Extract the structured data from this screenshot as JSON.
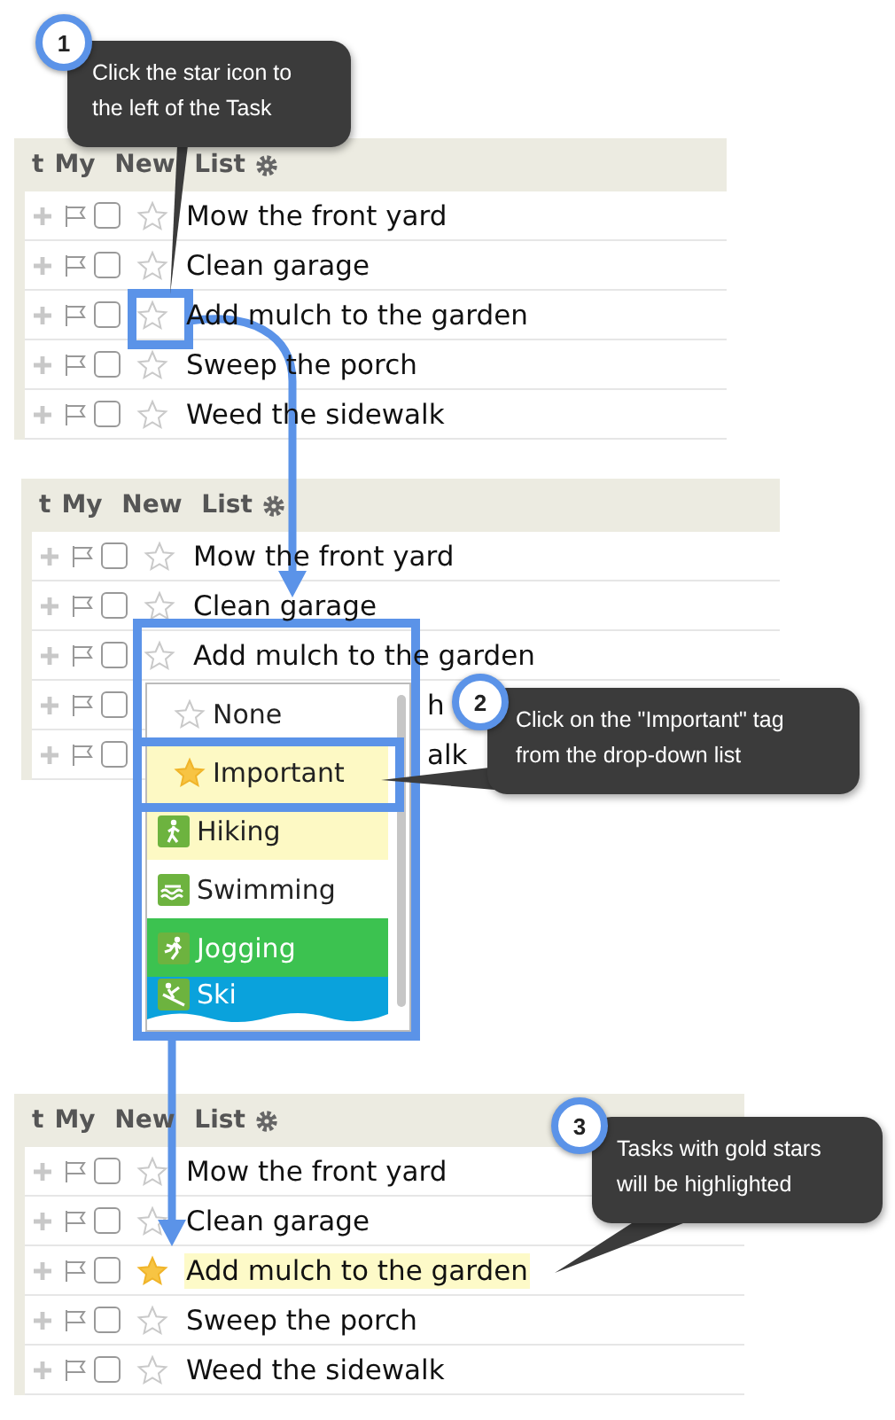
{
  "panels": [
    {
      "handle": "t",
      "title": "My New List",
      "tasks": [
        {
          "kind": "full",
          "text": "Mow the front yard",
          "done": false,
          "starred": false,
          "highlighted": false
        },
        {
          "kind": "full",
          "text": "Clean garage",
          "done": false,
          "starred": false,
          "highlighted": false
        },
        {
          "kind": "full",
          "text": "Add mulch to the garden",
          "done": false,
          "starred": false,
          "highlighted": false
        },
        {
          "kind": "full",
          "text": "Sweep the porch",
          "done": false,
          "starred": false,
          "highlighted": false
        },
        {
          "kind": "full",
          "text": "Weed the sidewalk",
          "done": false,
          "starred": false,
          "highlighted": false
        }
      ]
    },
    {
      "handle": "t",
      "title": "My New List",
      "tasks": [
        {
          "kind": "full",
          "text": "Mow the front yard",
          "done": false,
          "starred": false,
          "highlighted": false
        },
        {
          "kind": "full",
          "text": "Clean garage",
          "done": false,
          "starred": false,
          "highlighted": false
        },
        {
          "kind": "full",
          "text": "Add mulch to the garden",
          "done": false,
          "starred": false,
          "highlighted": false
        },
        {
          "kind": "partial",
          "text": "h",
          "done": false
        },
        {
          "kind": "partial",
          "text": "alk",
          "done": false
        }
      ]
    },
    {
      "handle": "t",
      "title": "My New List",
      "tasks": [
        {
          "kind": "full",
          "text": "Mow the front yard",
          "done": false,
          "starred": false,
          "highlighted": false
        },
        {
          "kind": "full",
          "text": "Clean garage",
          "done": false,
          "starred": false,
          "highlighted": false
        },
        {
          "kind": "full",
          "text": "Add mulch to the garden",
          "done": false,
          "starred": true,
          "highlighted": true
        },
        {
          "kind": "full",
          "text": "Sweep the porch",
          "done": false,
          "starred": false,
          "highlighted": false
        },
        {
          "kind": "full",
          "text": "Weed the sidewalk",
          "done": false,
          "starred": false,
          "highlighted": false
        }
      ]
    }
  ],
  "dropdown": {
    "items": [
      {
        "kind": "none",
        "label": "None",
        "selected": false,
        "color": "#ffffff"
      },
      {
        "kind": "important",
        "label": "Important",
        "selected": true,
        "color": "#fdf9c4"
      },
      {
        "kind": "hiking",
        "label": "Hiking",
        "selected": false,
        "color": "#fdf9c4"
      },
      {
        "kind": "swimming",
        "label": "Swimming",
        "selected": false,
        "color": "#ffffff"
      },
      {
        "kind": "jogging",
        "label": "Jogging",
        "selected": false,
        "color": "#3cc250"
      },
      {
        "kind": "skiing",
        "label": "Ski",
        "selected": false,
        "color": "#0aa2dc"
      }
    ]
  },
  "callouts": [
    {
      "number": "1",
      "text": "Click the star icon to the left of the Task"
    },
    {
      "number": "2",
      "text": "Click on the \"Important\" tag from the drop-down list"
    },
    {
      "number": "3",
      "text": "Tasks with gold stars will be highlighted"
    }
  ]
}
